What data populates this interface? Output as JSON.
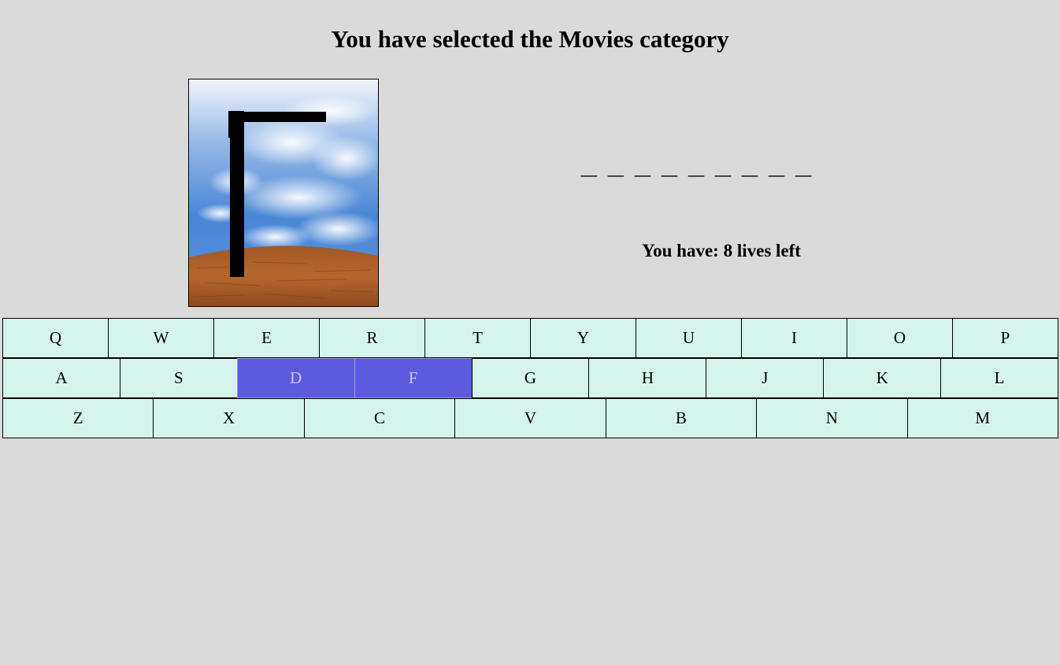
{
  "header": {
    "title": "You have selected the Movies category"
  },
  "game": {
    "word_display": "_ _ _ _ _ _ _ _ _",
    "lives_text": "You have: 8 lives left",
    "lives_remaining": 8,
    "category": "Movies"
  },
  "keyboard": {
    "rows": [
      [
        "Q",
        "W",
        "E",
        "R",
        "T",
        "Y",
        "U",
        "I",
        "O",
        "P"
      ],
      [
        "A",
        "S",
        "D",
        "F",
        "G",
        "H",
        "J",
        "K",
        "L"
      ],
      [
        "Z",
        "X",
        "C",
        "V",
        "B",
        "N",
        "M"
      ]
    ],
    "used_letters": [
      "D",
      "F"
    ]
  },
  "colors": {
    "background": "#dadada",
    "key": "#d5f4ec",
    "key_used": "#5d5ae0",
    "gallows": "#000000",
    "sky": "#4a86d6",
    "ground": "#a65a2a"
  }
}
